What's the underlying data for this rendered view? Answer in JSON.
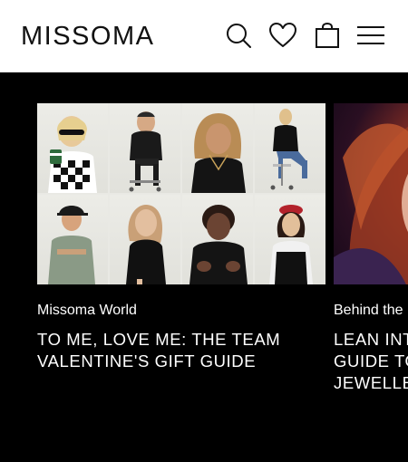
{
  "header": {
    "logo": "MISSOMA",
    "icons": [
      "search-icon",
      "heart-icon",
      "bag-icon",
      "menu-icon"
    ]
  },
  "cards": [
    {
      "category": "Missoma World",
      "title_lines": [
        "TO ME, LOVE ME: THE TEAM",
        "VALENTINE'S GIFT GUIDE"
      ]
    },
    {
      "category": "Behind the",
      "title_lines": [
        "LEAN INT",
        "GUIDE TO",
        "JEWELLE"
      ]
    }
  ],
  "colors": {
    "header_bg": "#ffffff",
    "page_bg": "#000000",
    "text_light": "#ffffff",
    "text_dark": "#111111"
  }
}
